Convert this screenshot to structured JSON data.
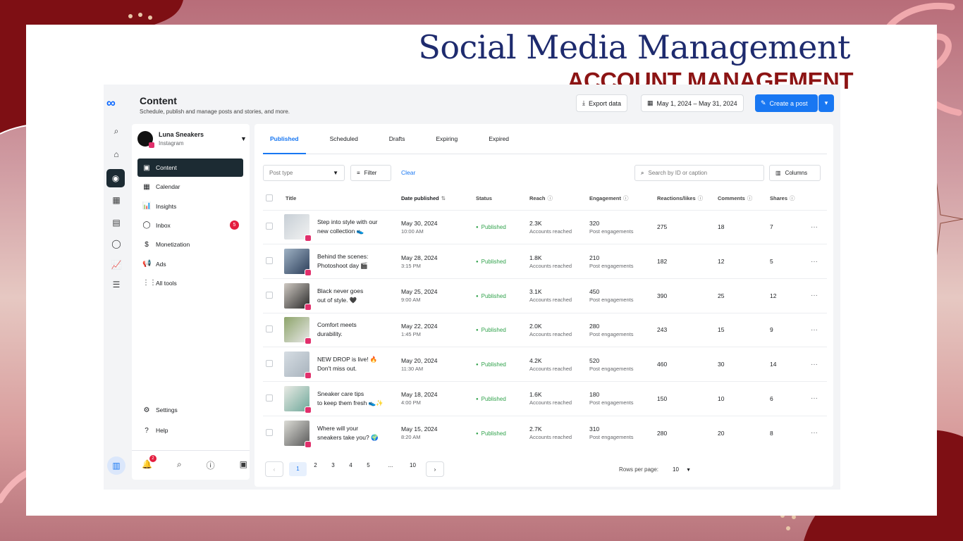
{
  "banner": {
    "title": "Social Media Management",
    "subtitle": "ACCOUNT MANAGEMENT"
  },
  "colors": {
    "accent": "#1877f2",
    "dark_nav": "#1c2b33",
    "brand_red": "#8c1414",
    "heading_blue": "#1e2b6e",
    "status_green": "#31a24c"
  },
  "app": {
    "logo_icon": "meta-logo-icon",
    "title": "Content",
    "subtitle": "Schedule, publish and manage posts and stories, and more.",
    "export_label": "Export data",
    "date_range": "May 1, 2024 – May 31, 2024",
    "create_label": "Create a post"
  },
  "rail": [
    "search-icon",
    "home-icon",
    "content-icon",
    "calendar-icon",
    "ads-icon",
    "inbox-icon",
    "insights-icon",
    "menu-icon"
  ],
  "account": {
    "name": "Luna Sneakers",
    "platform": "Instagram"
  },
  "nav": [
    {
      "label": "Content",
      "icon": "content-icon",
      "active": true
    },
    {
      "label": "Calendar",
      "icon": "calendar-icon"
    },
    {
      "label": "Insights",
      "icon": "insights-icon"
    },
    {
      "label": "Inbox",
      "icon": "inbox-icon",
      "badge": "5"
    },
    {
      "label": "Monetization",
      "icon": "dollar-icon"
    },
    {
      "label": "Ads",
      "icon": "megaphone-icon"
    },
    {
      "label": "All tools",
      "icon": "grid-icon"
    }
  ],
  "nav_bottom": [
    {
      "label": "Settings",
      "icon": "gear-icon"
    },
    {
      "label": "Help",
      "icon": "help-icon"
    }
  ],
  "bottombar": {
    "notif_badge": "2"
  },
  "tabs": [
    "Published",
    "Scheduled",
    "Drafts",
    "Expiring",
    "Expired"
  ],
  "filters": {
    "post_type_placeholder": "Post type",
    "filter_label": "Filter",
    "clear_label": "Clear",
    "search_placeholder": "Search by ID or caption",
    "columns_label": "Columns"
  },
  "table": {
    "headers": [
      "Title",
      "Date published",
      "Status",
      "Reach",
      "Engagement",
      "Reactions/likes",
      "Comments",
      "Shares"
    ],
    "rows": [
      {
        "title1": "Step into style with our",
        "title2": "new collection 👟",
        "date": "May 30, 2024",
        "time": "10:00 AM",
        "status": "Published",
        "reach": "2.3K",
        "reach_sub": "Accounts reached",
        "eng": "320",
        "eng_sub": "Post engagements",
        "likes": "275",
        "comments": "18",
        "shares": "7"
      },
      {
        "title1": "Behind the scenes:",
        "title2": "Photoshoot day 🎬",
        "date": "May 28, 2024",
        "time": "3:15 PM",
        "status": "Published",
        "reach": "1.8K",
        "reach_sub": "Accounts reached",
        "eng": "210",
        "eng_sub": "Post engagements",
        "likes": "182",
        "comments": "12",
        "shares": "5"
      },
      {
        "title1": "Black never goes",
        "title2": "out of style. 🖤",
        "date": "May 25, 2024",
        "time": "9:00 AM",
        "status": "Published",
        "reach": "3.1K",
        "reach_sub": "Accounts reached",
        "eng": "450",
        "eng_sub": "Post engagements",
        "likes": "390",
        "comments": "25",
        "shares": "12"
      },
      {
        "title1": "Comfort meets",
        "title2": "durability.",
        "date": "May 22, 2024",
        "time": "1:45 PM",
        "status": "Published",
        "reach": "2.0K",
        "reach_sub": "Accounts reached",
        "eng": "280",
        "eng_sub": "Post engagements",
        "likes": "243",
        "comments": "15",
        "shares": "9"
      },
      {
        "title1": "NEW DROP is live! 🔥",
        "title2": "Don't miss out.",
        "date": "May 20, 2024",
        "time": "11:30 AM",
        "status": "Published",
        "reach": "4.2K",
        "reach_sub": "Accounts reached",
        "eng": "520",
        "eng_sub": "Post engagements",
        "likes": "460",
        "comments": "30",
        "shares": "14"
      },
      {
        "title1": "Sneaker care tips",
        "title2": "to keep them fresh 👟✨",
        "date": "May 18, 2024",
        "time": "4:00 PM",
        "status": "Published",
        "reach": "1.6K",
        "reach_sub": "Accounts reached",
        "eng": "180",
        "eng_sub": "Post engagements",
        "likes": "150",
        "comments": "10",
        "shares": "6"
      },
      {
        "title1": "Where will your",
        "title2": "sneakers take you? 🌍",
        "date": "May 15, 2024",
        "time": "8:20 AM",
        "status": "Published",
        "reach": "2.7K",
        "reach_sub": "Accounts reached",
        "eng": "310",
        "eng_sub": "Post engagements",
        "likes": "280",
        "comments": "20",
        "shares": "8"
      }
    ]
  },
  "pagination": {
    "pages": [
      "1",
      "2",
      "3",
      "4",
      "5",
      "...",
      "10"
    ],
    "rows_label": "Rows per page:",
    "rows_value": "10"
  }
}
